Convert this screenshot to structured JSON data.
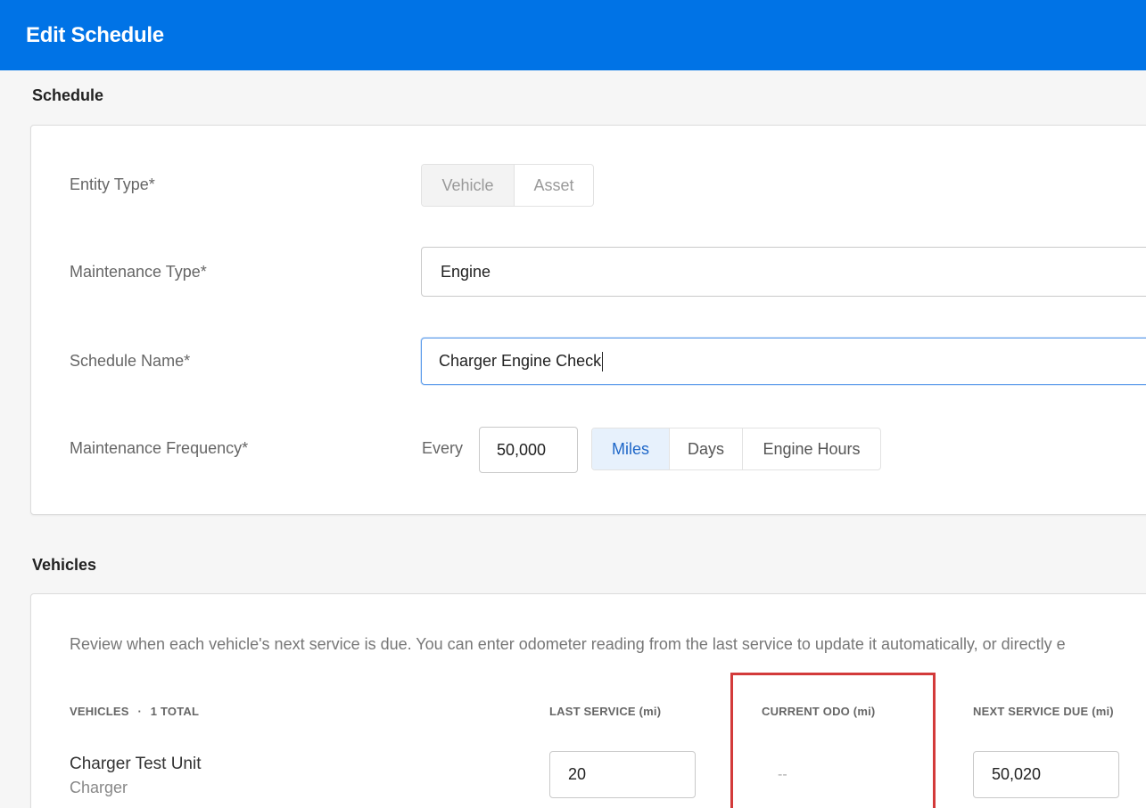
{
  "header": {
    "title": "Edit Schedule"
  },
  "schedule": {
    "section_title": "Schedule",
    "entity_type": {
      "label": "Entity Type*",
      "options": [
        "Vehicle",
        "Asset"
      ],
      "selected": "Vehicle"
    },
    "maintenance_type": {
      "label": "Maintenance Type*",
      "value": "Engine"
    },
    "schedule_name": {
      "label": "Schedule Name*",
      "value": "Charger Engine Check"
    },
    "frequency": {
      "label": "Maintenance Frequency*",
      "prefix": "Every",
      "value": "50,000",
      "units": [
        "Miles",
        "Days",
        "Engine Hours"
      ],
      "selected_unit": "Miles"
    }
  },
  "vehicles": {
    "section_title": "Vehicles",
    "description": "Review when each vehicle's next service is due. You can enter odometer reading from the last service to update it automatically, or directly e",
    "columns": {
      "vehicles": "VEHICLES",
      "separator": "·",
      "total": "1 TOTAL",
      "last_service": "LAST SERVICE (mi)",
      "current_odo": "CURRENT ODO (mi)",
      "next_service": "NEXT SERVICE DUE (mi)"
    },
    "rows": [
      {
        "name": "Charger Test Unit",
        "subtitle": "Charger",
        "last_service": "20",
        "current_odo": "--",
        "next_service": "50,020"
      }
    ]
  },
  "colors": {
    "header": "#0073e6",
    "selected_segment": "#e7f1fc",
    "highlight": "#d33a3a"
  }
}
